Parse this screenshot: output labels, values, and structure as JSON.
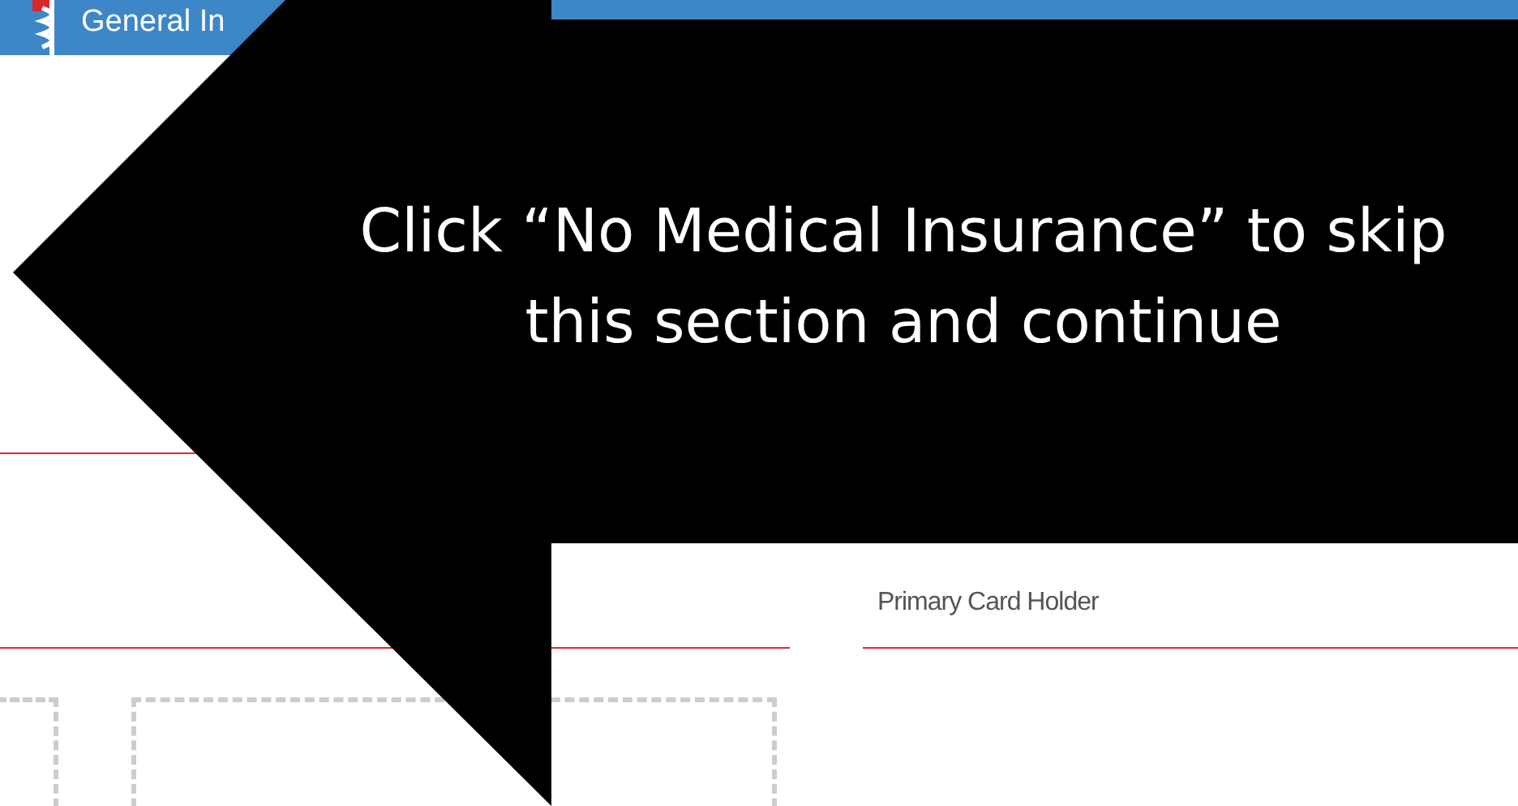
{
  "top_bar": {
    "tab_label": "General In"
  },
  "section": {
    "label": "Primary Card Holder"
  },
  "callout": {
    "text": "Click “No Medical Insurance” to skip this section and continue"
  }
}
